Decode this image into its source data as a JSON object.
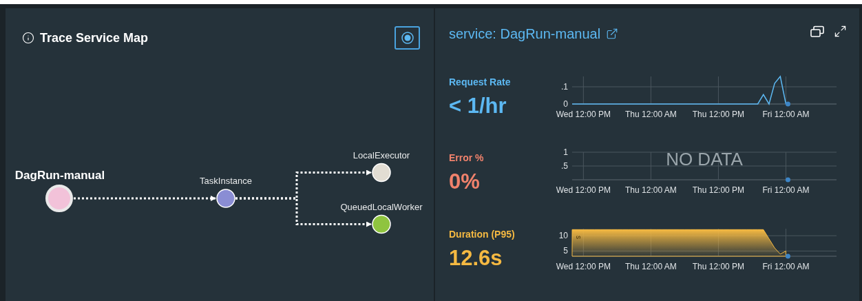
{
  "service_map": {
    "title": "Trace Service Map",
    "root": {
      "name": "DagRun-manual",
      "color": "#f2c2d9",
      "children": [
        {
          "name": "TaskInstance",
          "color": "#8a8dd4",
          "children": [
            {
              "name": "LocalExecutor",
              "color": "#e2ddd3"
            },
            {
              "name": "QueuedLocalWorker",
              "color": "#8fc43f"
            }
          ]
        }
      ]
    }
  },
  "service_panel": {
    "title": "service: DagRun-manual",
    "metrics": [
      {
        "label": "Request Rate",
        "value": "< 1/hr",
        "color": "#5cb8f2",
        "chart_data": {
          "type": "line",
          "grid": true,
          "ylim": [
            0,
            0.16
          ],
          "yticks": [
            {
              "value": 0,
              "label": "0"
            },
            {
              "value": 0.1,
              "label": ".1"
            }
          ],
          "categories": [
            null,
            null,
            "Wed 12:00 PM",
            null,
            null,
            null,
            null,
            null,
            null,
            null,
            null,
            null,
            null,
            null,
            "Thu 12:00 AM",
            null,
            null,
            null,
            null,
            null,
            null,
            null,
            null,
            null,
            null,
            null,
            "Thu 12:00 PM",
            null,
            null,
            null,
            null,
            null,
            null,
            null,
            null,
            null,
            null,
            null,
            "Fri 12:00 AM",
            null,
            null,
            null,
            null,
            null,
            null,
            null,
            null,
            null
          ],
          "series": [
            {
              "color": "#5cb8f2",
              "values": [
                0,
                0,
                0,
                0,
                0,
                0,
                0,
                0,
                0,
                0,
                0,
                0,
                0,
                0,
                0,
                0,
                0,
                0,
                0,
                0,
                0,
                0,
                0,
                0,
                0,
                0,
                0,
                0,
                0,
                0,
                0,
                0,
                0,
                0,
                0.055,
                0,
                0.12,
                0.16,
                0,
                null,
                null,
                null,
                null,
                null,
                null,
                null,
                null,
                null
              ]
            }
          ]
        }
      },
      {
        "label": "Error %",
        "value": "0%",
        "color": "#f0826c",
        "no_data": "NO DATA",
        "chart_data": {
          "type": "line",
          "grid": true,
          "ylim": [
            0,
            1
          ],
          "yticks": [
            {
              "value": 0.5,
              "label": ".5"
            },
            {
              "value": 1,
              "label": "1"
            }
          ],
          "categories": [
            null,
            null,
            "Wed 12:00 PM",
            null,
            null,
            null,
            null,
            null,
            null,
            null,
            null,
            null,
            null,
            null,
            "Thu 12:00 AM",
            null,
            null,
            null,
            null,
            null,
            null,
            null,
            null,
            null,
            null,
            null,
            "Thu 12:00 PM",
            null,
            null,
            null,
            null,
            null,
            null,
            null,
            null,
            null,
            null,
            null,
            "Fri 12:00 AM",
            null,
            null,
            null,
            null,
            null,
            null,
            null,
            null,
            null
          ],
          "series": [
            {
              "color": "#3d85c6",
              "marker": true,
              "values": [
                null,
                null,
                null,
                null,
                null,
                null,
                null,
                null,
                null,
                null,
                null,
                null,
                null,
                null,
                null,
                null,
                null,
                null,
                null,
                null,
                null,
                null,
                null,
                null,
                null,
                null,
                null,
                null,
                null,
                null,
                null,
                null,
                null,
                null,
                null,
                null,
                null,
                null,
                0,
                null,
                null,
                null,
                null,
                null,
                null,
                null,
                null,
                null
              ]
            }
          ]
        }
      },
      {
        "label": "Duration (P95)",
        "value": "12.6s",
        "color": "#f5b942",
        "chart_data": {
          "type": "area",
          "grid": true,
          "ylabel": "s",
          "ylim": [
            3.3,
            12.3
          ],
          "yticks": [
            {
              "value": 5,
              "label": "5"
            },
            {
              "value": 10,
              "label": "10"
            }
          ],
          "categories": [
            null,
            null,
            "Wed 12:00 PM",
            null,
            null,
            null,
            null,
            null,
            null,
            null,
            null,
            null,
            null,
            null,
            "Thu 12:00 AM",
            null,
            null,
            null,
            null,
            null,
            null,
            null,
            null,
            null,
            null,
            null,
            "Thu 12:00 PM",
            null,
            null,
            null,
            null,
            null,
            null,
            null,
            null,
            null,
            null,
            null,
            "Fri 12:00 AM",
            null,
            null,
            null,
            null,
            null,
            null,
            null,
            null,
            null
          ],
          "series": [
            {
              "color": "#f5b942",
              "values": [
                12,
                12,
                12,
                12,
                12,
                12,
                12,
                12,
                12,
                12,
                12,
                12,
                12,
                12,
                12,
                12,
                12,
                12,
                12,
                12,
                12,
                12,
                12,
                12,
                12,
                12,
                12,
                12,
                12,
                12,
                12,
                12,
                12,
                12,
                12,
                9,
                6,
                4,
                5,
                null,
                null,
                null,
                null,
                null,
                null,
                null,
                null,
                null
              ]
            }
          ]
        }
      }
    ]
  }
}
